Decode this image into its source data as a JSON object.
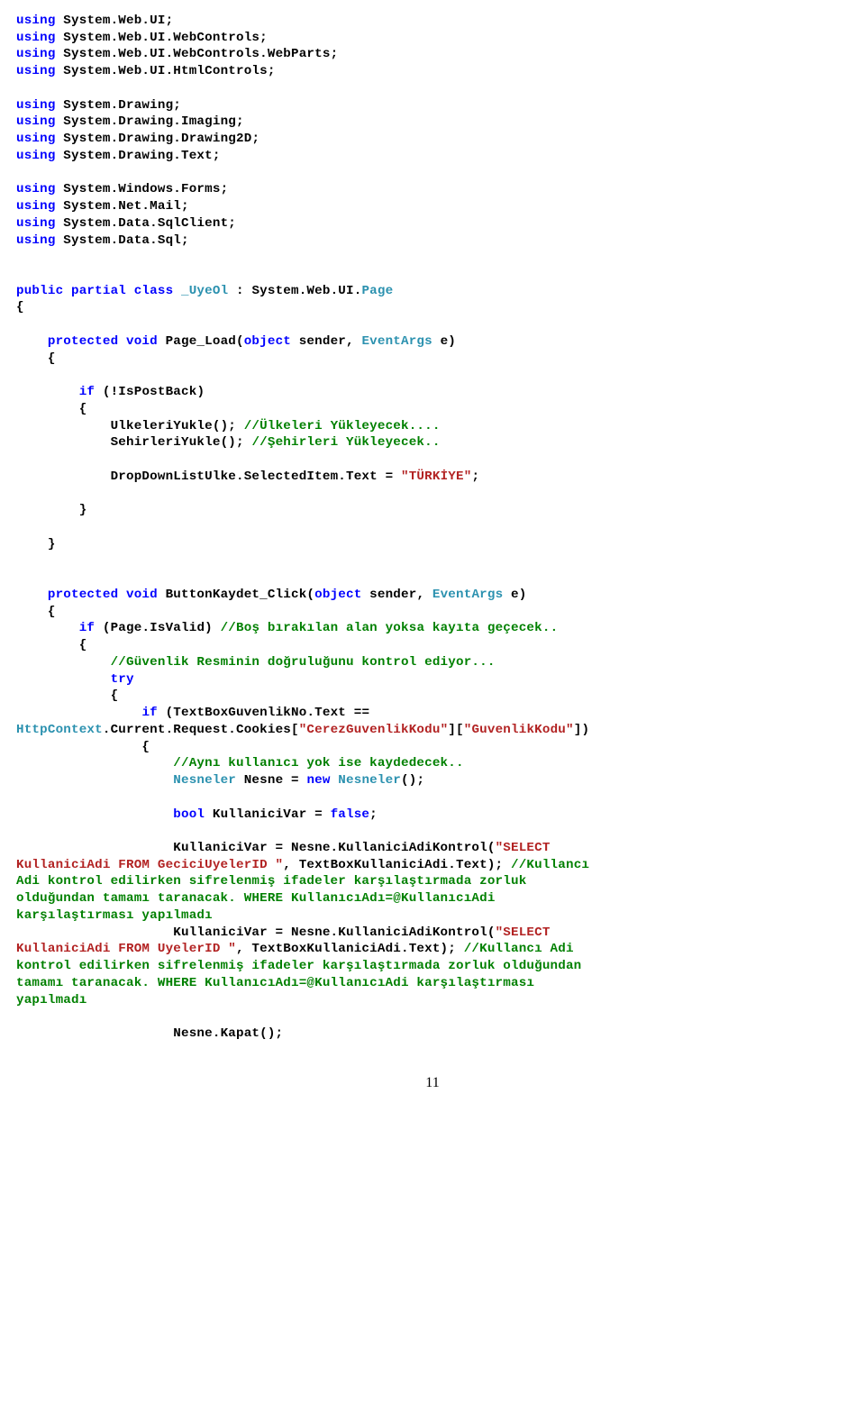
{
  "usings": [
    {
      "pre": "using ",
      "mid": "System.Web.UI",
      "suf": ";"
    },
    {
      "pre": "using ",
      "mid": "System.Web.UI.WebControls",
      "suf": ";"
    },
    {
      "pre": "using ",
      "mid": "System.Web.UI.WebControls.WebParts",
      "suf": ";"
    },
    {
      "pre": "using ",
      "mid": "System.Web.UI.HtmlControls",
      "suf": ";"
    }
  ],
  "usings2": [
    {
      "pre": "using ",
      "mid": "System.Drawing",
      "suf": ";"
    },
    {
      "pre": "using ",
      "mid": "System.Drawing.Imaging",
      "suf": ";"
    },
    {
      "pre": "using ",
      "mid": "System.Drawing.Drawing2D",
      "suf": ";"
    },
    {
      "pre": "using ",
      "mid": "System.Drawing.Text",
      "suf": ";"
    }
  ],
  "usings3": [
    {
      "pre": "using ",
      "mid": "System.Windows.Forms",
      "suf": ";"
    },
    {
      "pre": "using ",
      "mid": "System.Net.Mail",
      "suf": ";"
    },
    {
      "pre": "using ",
      "mid": "System.Data.SqlClient",
      "suf": ";"
    },
    {
      "pre": "using ",
      "mid": "System.Data.Sql",
      "suf": ";"
    }
  ],
  "classLine": {
    "p1": "public partial class ",
    "p2": "_UyeOl",
    "p3": " : System.Web.UI.",
    "p4": "Page"
  },
  "brace_open": "{",
  "brace_close": "}",
  "pageLoad": {
    "indent": "    ",
    "p1": "protected void ",
    "p2": "Page_Load(",
    "p3": "object ",
    "p4": "sender, ",
    "p5": "EventArgs ",
    "p6": "e)"
  },
  "ifPost": {
    "indent": "        ",
    "p1": "if ",
    "p2": "(!IsPostBack)"
  },
  "ln_ulk": {
    "indent": "            ",
    "txt": "UlkeleriYukle(); ",
    "cmt": "//Ülkeleri Yükleyecek...."
  },
  "ln_seh": {
    "indent": "            ",
    "txt": "SehirleriYukle(); ",
    "cmt": "//Şehirleri Yükleyecek.."
  },
  "ln_drop": {
    "indent": "            ",
    "txt": "DropDownListUlke.SelectedItem.Text = ",
    "str": "\"TÜRKİYE\"",
    "suf": ";"
  },
  "brace_close_i2": "        }",
  "brace_close_i1": "    }",
  "btnClick": {
    "indent": "    ",
    "p1": "protected void ",
    "p2": "ButtonKaydet_Click(",
    "p3": "object ",
    "p4": "sender, ",
    "p5": "EventArgs ",
    "p6": "e)"
  },
  "ifValid": {
    "indent": "        ",
    "p1": "if ",
    "p2": "(Page.IsValid) ",
    "cmt": "//Boş bırakılan alan yoksa kayıta geçecek.."
  },
  "brace_open_i2": "        {",
  "cmt_guv": {
    "indent": "            ",
    "cmt": "//Güvenlik Resminin doğruluğunu kontrol ediyor..."
  },
  "tryLine": {
    "indent": "            ",
    "txt": "try"
  },
  "brace_open_i3": "            {",
  "ifGuv": {
    "indent": "                ",
    "p1": "if ",
    "p2": "(TextBoxGuvenlikNo.Text =="
  },
  "httpLine": {
    "p1": "HttpContext",
    "p2": ".Current.Request.Cookies[",
    "s1": "\"CerezGuvenlikKodu\"",
    "p3": "][",
    "s2": "\"GuvenlikKodu\"",
    "p4": "])"
  },
  "brace_open_i4": "                {",
  "cmt_ayni": {
    "indent": "                    ",
    "cmt": "//Aynı kullanıcı yok ise kaydedecek.."
  },
  "nesneLine": {
    "indent": "                    ",
    "p1": "Nesneler ",
    "p2": "Nesne = ",
    "p3": "new ",
    "p4": "Nesneler",
    "p5": "();"
  },
  "boolLine": {
    "indent": "                    ",
    "p1": "bool ",
    "p2": "KullaniciVar = ",
    "p3": "false",
    "p4": ";"
  },
  "kv1": {
    "indent": "                    ",
    "txt": "KullaniciVar = Nesne.KullaniciAdiKontrol(",
    "str": "\"SELECT"
  },
  "kv1b": {
    "str": "KullaniciAdi FROM GeciciUyelerID \"",
    "txt": ", TextBoxKullaniciAdi.Text); ",
    "cmt": "//Kullancı"
  },
  "kv1c": "Adi kontrol edilirken sifrelenmiş ifadeler karşılaştırmada zorluk",
  "kv1d": "olduğundan tamamı taranacak. WHERE KullanıcıAdı=@KullanıcıAdi",
  "kv1e": "karşılaştırması yapılmadı",
  "kv2": {
    "indent": "                    ",
    "txt": "KullaniciVar = Nesne.KullaniciAdiKontrol(",
    "str": "\"SELECT"
  },
  "kv2b": {
    "str": "KullaniciAdi FROM UyelerID \"",
    "txt": ", TextBoxKullaniciAdi.Text); ",
    "cmt": "//Kullancı Adi"
  },
  "kv2c": "kontrol edilirken sifrelenmiş ifadeler karşılaştırmada zorluk olduğundan",
  "kv2d": "tamamı taranacak. WHERE KullanıcıAdı=@KullanıcıAdi karşılaştırması",
  "kv2e": "yapılmadı",
  "kapat": {
    "indent": "                    ",
    "txt": "Nesne.Kapat();"
  },
  "pageNum": "11"
}
